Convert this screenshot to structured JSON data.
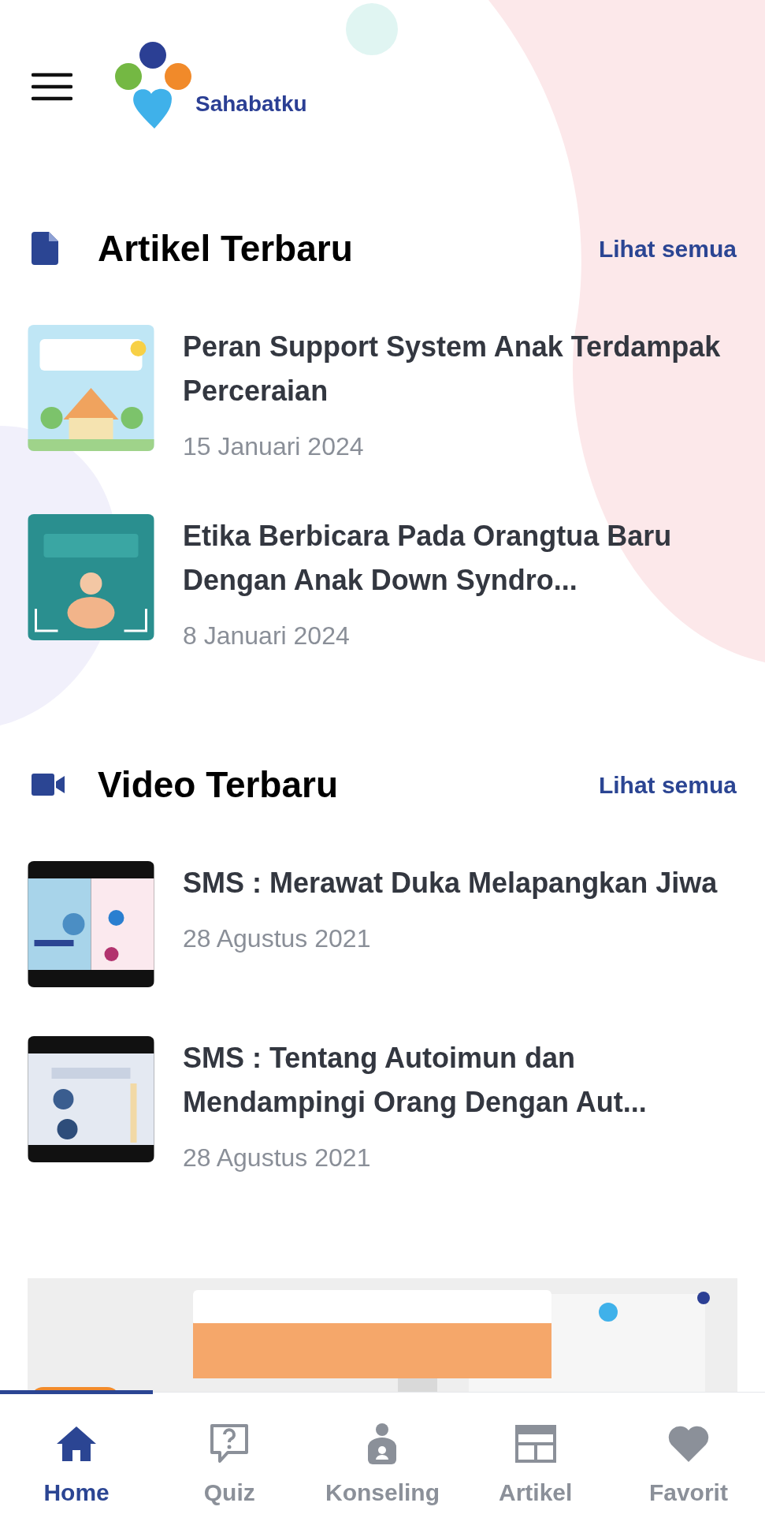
{
  "header": {
    "logo_text": "Sahabatku"
  },
  "sections": [
    {
      "kind": "article",
      "title": "Artikel Terbaru",
      "link": "Lihat semua",
      "items": [
        {
          "title": "Peran Support System Anak Terdampak Perceraian",
          "date": "15 Januari 2024"
        },
        {
          "title": "Etika Berbicara Pada Orangtua Baru Dengan Anak Down Syndro...",
          "date": "8 Januari 2024"
        }
      ]
    },
    {
      "kind": "video",
      "title": "Video Terbaru",
      "link": "Lihat semua",
      "items": [
        {
          "title": "SMS : Merawat Duka Melapangkan Jiwa",
          "date": "28 Agustus 2021"
        },
        {
          "title": "SMS : Tentang Autoimun dan Mendampingi Orang Dengan Aut...",
          "date": "28 Agustus 2021"
        }
      ]
    }
  ],
  "bottom_nav": [
    {
      "kind": "home",
      "label": "Home",
      "selected": true
    },
    {
      "kind": "quiz",
      "label": "Quiz",
      "selected": false
    },
    {
      "kind": "counsel",
      "label": "Konseling",
      "selected": false
    },
    {
      "kind": "article",
      "label": "Artikel",
      "selected": false
    },
    {
      "kind": "favorite",
      "label": "Favorit",
      "selected": false
    }
  ]
}
